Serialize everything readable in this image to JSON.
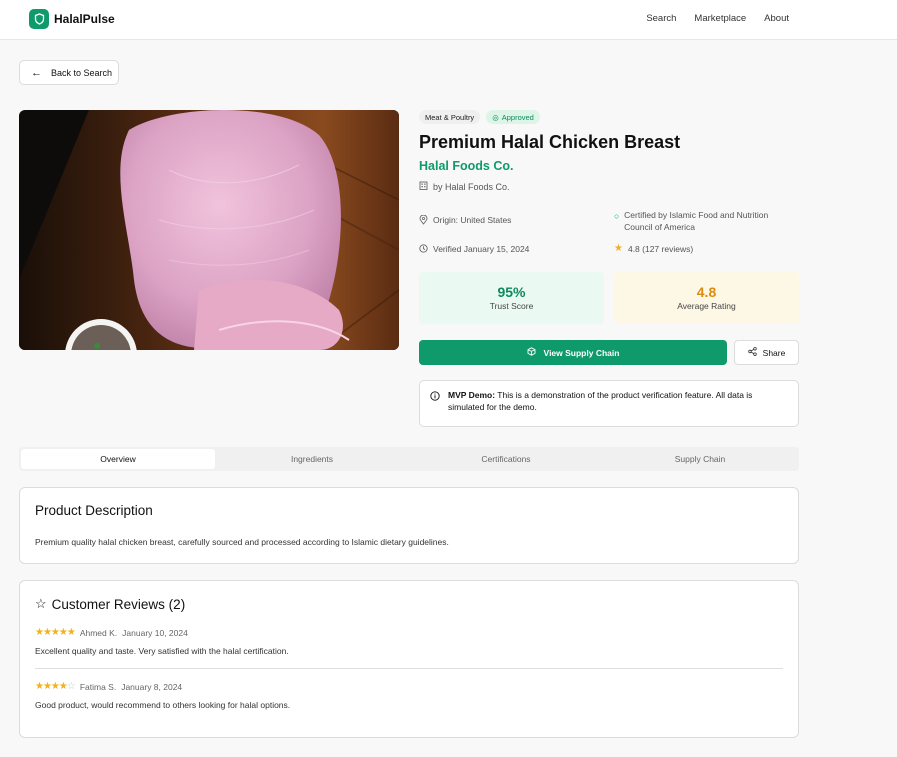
{
  "app": {
    "name": "HalalPulse"
  },
  "nav": {
    "links": [
      "Search",
      "Marketplace",
      "About"
    ]
  },
  "back_label": "Back to Search",
  "product": {
    "category": "Meat & Poultry",
    "status": "Approved",
    "title": "Premium Halal Chicken Breast",
    "brand": "Halal Foods Co.",
    "byline": "by Halal Foods Co.",
    "origin": "Origin: United States",
    "certified": "Certified by Islamic Food and Nutrition Council of America",
    "verified": "Verified January 15, 2024",
    "rating_text": "4.8 (127 reviews)",
    "trust_score": "95%",
    "trust_label": "Trust Score",
    "avg_rating": "4.8",
    "avg_rating_label": "Average Rating"
  },
  "actions": {
    "supply_chain": "View Supply Chain",
    "share": "Share"
  },
  "notice": {
    "bold": "MVP Demo:",
    "text": " This is a demonstration of the product verification feature. All data is simulated for the demo."
  },
  "tabs": [
    "Overview",
    "Ingredients",
    "Certifications",
    "Supply Chain"
  ],
  "description": {
    "title": "Product Description",
    "text": "Premium quality halal chicken breast, carefully sourced and processed according to Islamic dietary guidelines."
  },
  "reviews": {
    "title": "Customer Reviews (2)",
    "items": [
      {
        "author": "Ahmed K.",
        "date": "January 10, 2024",
        "rating": 5,
        "text": "Excellent quality and taste. Very satisfied with the halal certification."
      },
      {
        "author": "Fatima S.",
        "date": "January 8, 2024",
        "rating": 4,
        "text": "Good product, would recommend to others looking for halal options."
      }
    ]
  },
  "colors": {
    "brand": "#0e9a6b",
    "star": "#f2b21b",
    "rating": "#d98c10"
  }
}
